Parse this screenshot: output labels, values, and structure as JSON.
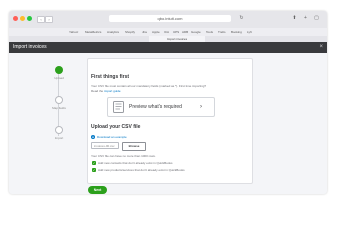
{
  "browser": {
    "address": "qbo.intuit.com",
    "tab_title": "Import invoices",
    "bookmarks": [
      "Yahoo!",
      "MetaMetrics",
      "Analytics",
      "Shopify",
      "Jira",
      "Apple",
      "ICA",
      "UPS",
      "ADB",
      "Google",
      "Tools",
      "Trello",
      "Booking",
      "Lyft"
    ]
  },
  "header": {
    "title": "Import invoices",
    "close": "×"
  },
  "steps": [
    {
      "label": "Upload"
    },
    {
      "label": "Map fields"
    },
    {
      "label": "Import"
    }
  ],
  "first_things": {
    "title": "First things first",
    "line1": "Your CSV file must contain all our mandatory fields (marked as *). First time importing?",
    "line2_prefix": "Read the",
    "link": "import guide",
    "preview_label": "Preview what's required",
    "preview_arrow": "›"
  },
  "upload": {
    "title": "Upload your CSV file",
    "download_link": "Download an example",
    "file_placeholder": "invoices-00.csv",
    "browse_label": "Browse",
    "limit_text": "Your CSV file can have no more than 1000 rows.",
    "checkbox1": "Add new contacts that don't already exist in QuickBooks",
    "checkbox2": "Add new products/services that don't already exist in QuickBooks"
  },
  "next_label": "Next",
  "colors": {
    "accent_green": "#2ca01c",
    "header_dark": "#393a3d",
    "link_blue": "#0077c5"
  }
}
